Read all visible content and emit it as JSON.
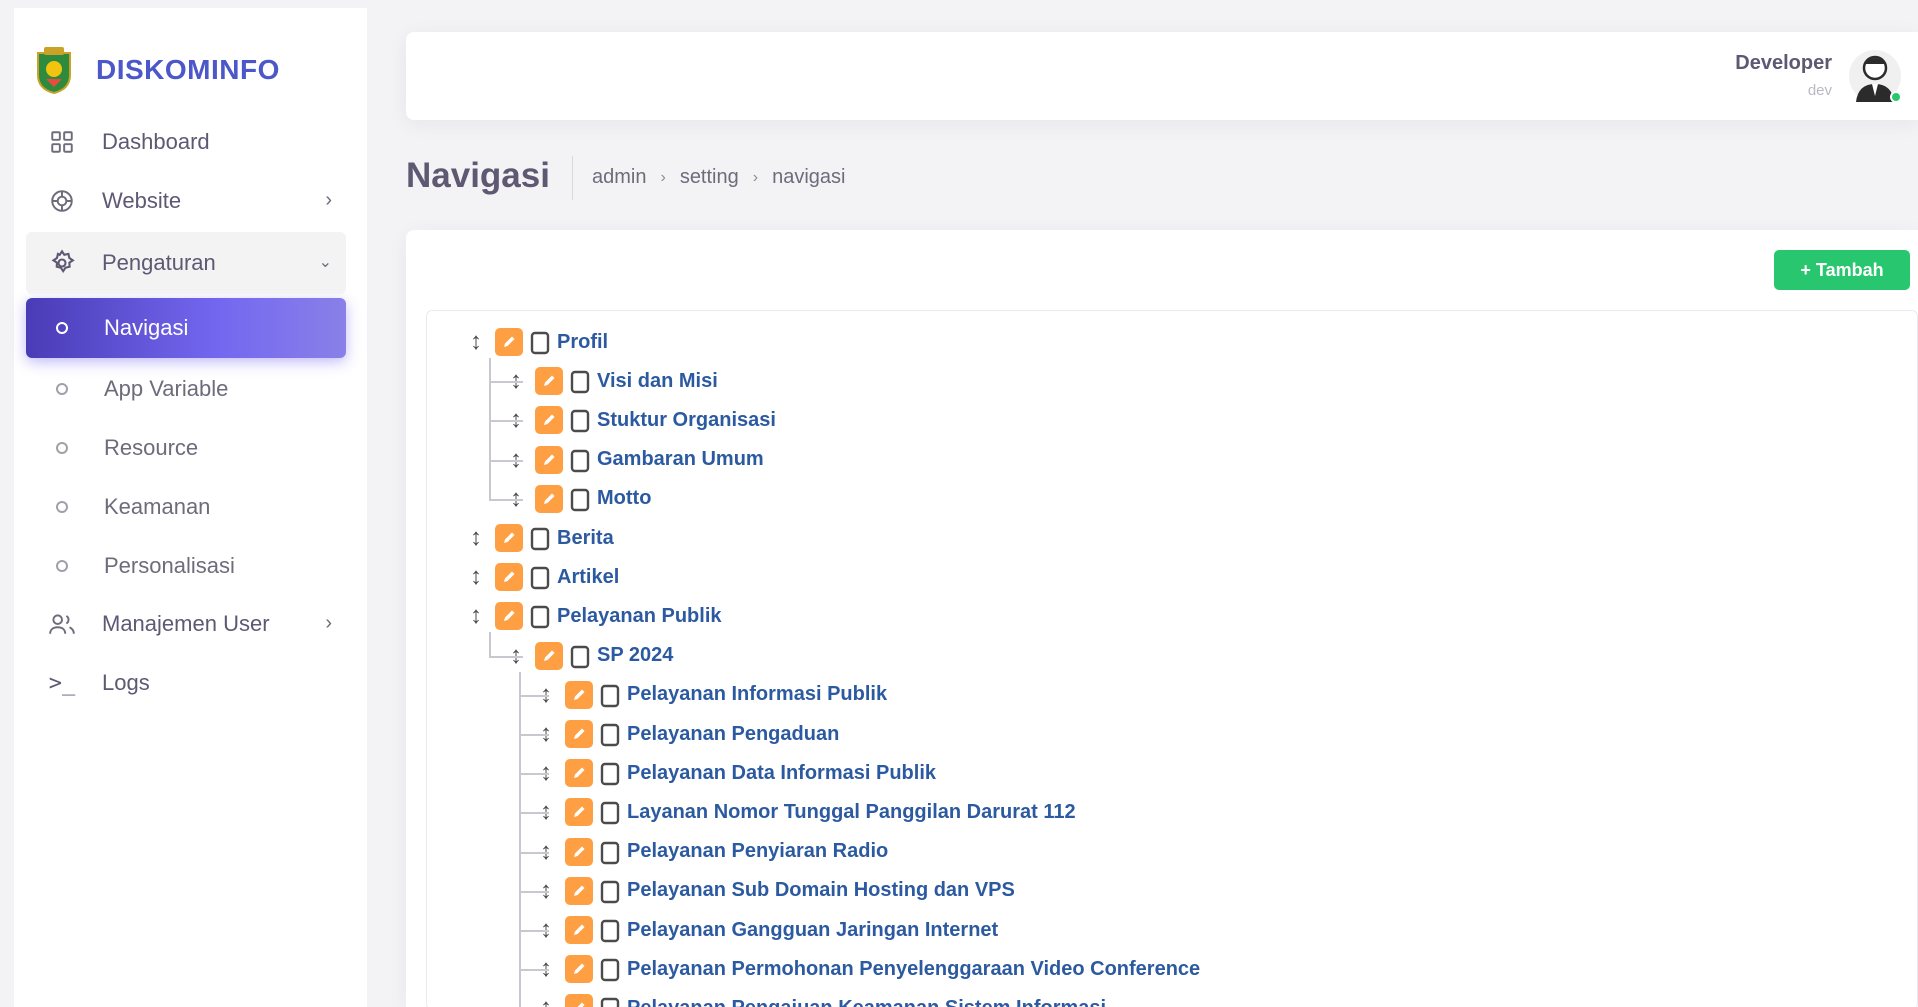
{
  "brand": {
    "name": "DISKOMINFO"
  },
  "sidebar": {
    "items": [
      {
        "label": "Dashboard",
        "icon": "grid-icon"
      },
      {
        "label": "Website",
        "icon": "globe-icon"
      },
      {
        "label": "Pengaturan",
        "icon": "gear-icon"
      }
    ],
    "sub_items": [
      {
        "label": "Navigasi",
        "active": true
      },
      {
        "label": "App Variable"
      },
      {
        "label": "Resource"
      },
      {
        "label": "Keamanan"
      },
      {
        "label": "Personalisasi"
      }
    ],
    "after_items": [
      {
        "label": "Manajemen User",
        "icon": "users-icon"
      },
      {
        "label": "Logs",
        "icon": "terminal-icon"
      }
    ]
  },
  "header": {
    "user_name": "Developer",
    "user_role": "dev"
  },
  "page": {
    "title": "Navigasi",
    "breadcrumb": [
      "admin",
      "setting",
      "navigasi"
    ]
  },
  "toolbar": {
    "add_label": "+ Tambah"
  },
  "colors": {
    "accent": "#7367f0",
    "brand": "#4c58c9",
    "success": "#28c76f",
    "warning": "#ff9f43",
    "link": "#2c5aa0"
  },
  "tree": [
    {
      "label": "Profil",
      "level": 0
    },
    {
      "label": "Visi dan Misi",
      "level": 1
    },
    {
      "label": "Stuktur Organisasi",
      "level": 1
    },
    {
      "label": "Gambaran Umum",
      "level": 1
    },
    {
      "label": "Motto",
      "level": 1
    },
    {
      "label": "Berita",
      "level": 0
    },
    {
      "label": "Artikel",
      "level": 0
    },
    {
      "label": "Pelayanan Publik",
      "level": 0
    },
    {
      "label": "SP 2024",
      "level": 1
    },
    {
      "label": "Pelayanan Informasi Publik",
      "level": 2
    },
    {
      "label": "Pelayanan Pengaduan",
      "level": 2
    },
    {
      "label": "Pelayanan Data Informasi Publik",
      "level": 2
    },
    {
      "label": "Layanan Nomor Tunggal Panggilan Darurat 112",
      "level": 2
    },
    {
      "label": "Pelayanan Penyiaran Radio",
      "level": 2
    },
    {
      "label": "Pelayanan Sub Domain Hosting dan VPS",
      "level": 2
    },
    {
      "label": "Pelayanan Gangguan Jaringan Internet",
      "level": 2
    },
    {
      "label": "Pelayanan Permohonan Penyelenggaraan Video Conference",
      "level": 2
    },
    {
      "label": "Pelayanan Pengajuan Keamanan Sistem Informasi",
      "level": 2
    }
  ]
}
